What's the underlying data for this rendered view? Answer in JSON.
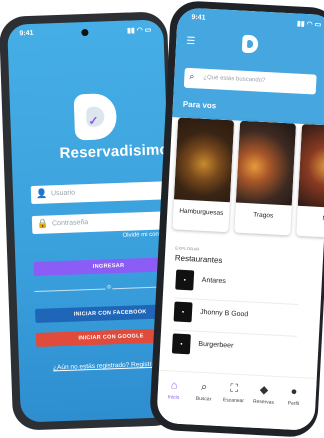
{
  "login": {
    "time": "9:41",
    "brand_name": "Reservadisimo",
    "user_placeholder": "Usuario",
    "password_placeholder": "Contraseña",
    "forgot_link": "Olvidé mi contra",
    "login_button": "INGRESAR",
    "separator": "o",
    "facebook_button": "INICIAR CON FACEBOOK",
    "google_button": "INICIAR CON GOOGLE",
    "register_link": "¿Aún no estás registrado? Registrate aquí"
  },
  "home": {
    "time": "9:41",
    "search_placeholder": "¿Qué estás buscando?",
    "section_title": "Para vos",
    "categories": [
      {
        "label": "Hamburguesas"
      },
      {
        "label": "Tragos"
      },
      {
        "label": "M"
      }
    ],
    "explore_label": "EXPLORAR",
    "restaurants_title": "Restaurantes",
    "restaurants": [
      {
        "name": "Antares"
      },
      {
        "name": "Jhonny B Good"
      },
      {
        "name": "Burgerbeer"
      }
    ],
    "tabs": [
      {
        "label": "Inicio",
        "icon": "home-icon"
      },
      {
        "label": "Buscar",
        "icon": "search-icon"
      },
      {
        "label": "Escanear",
        "icon": "scan-icon"
      },
      {
        "label": "Reservas",
        "icon": "reservations-icon"
      },
      {
        "label": "Perfil",
        "icon": "profile-icon"
      }
    ]
  },
  "colors": {
    "primary_blue": "#45a6e0",
    "accent_purple": "#8b5cf6",
    "facebook_blue": "#1f66b9",
    "google_red": "#e14b3b"
  }
}
